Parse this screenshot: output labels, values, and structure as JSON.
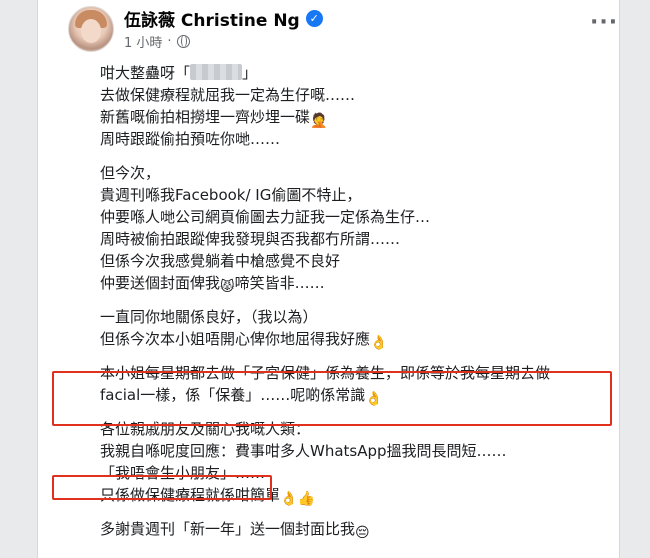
{
  "author": {
    "name": "伍詠薇 Christine Ng",
    "time": "1 小時",
    "privacy_icon": "globe-icon",
    "verified_icon": "verified-badge-icon"
  },
  "menu_icon": "more-options-icon",
  "post": {
    "p1": [
      "咁大整蠱呀「",
      "」",
      "去做保健療程就屈我一定為生仔嘅……",
      "新舊嘅偷拍相撈埋一齊炒埋一碟",
      "周時跟蹤偷拍預咗你哋……"
    ],
    "p2": [
      "但今次，",
      "貴週刊喺我Facebook/ IG偷圖不特止，",
      "仲要喺人哋公司網頁偷圖去力証我一定係為生仔…",
      "周時被偷拍跟蹤俾我發現與否我都冇所謂……",
      "但係今次我感覺躺着中槍感覺不良好",
      "仲要送個封面俾我",
      "啼笑皆非……"
    ],
    "p3": [
      "一直同你地關係良好，（我以為）",
      "但係今次本小姐唔開心俾你地屈得我好應"
    ],
    "p4": [
      "本小姐每星期都去做「子宮保健」係為養生，即係等於我每星期去做",
      "facial一樣，係「保養」……呢啲係常識"
    ],
    "p5": [
      "各位親戚朋友及關心我嘅人類：",
      "我親自喺呢度回應：費事咁多人WhatsApp搵我問長問短……",
      "「我唔會生小朋友」……",
      "只係做保健療程就係咁簡單"
    ],
    "p6": [
      "多謝貴週刊「新一年」送一個封面比我"
    ]
  },
  "emoji": {
    "facepalm": "🤦",
    "cat": "😾",
    "ok": "👌",
    "thumbs": "👍",
    "sad": "😔"
  },
  "colors": {
    "highlight": "#e0301e",
    "verified": "#1877f2"
  }
}
